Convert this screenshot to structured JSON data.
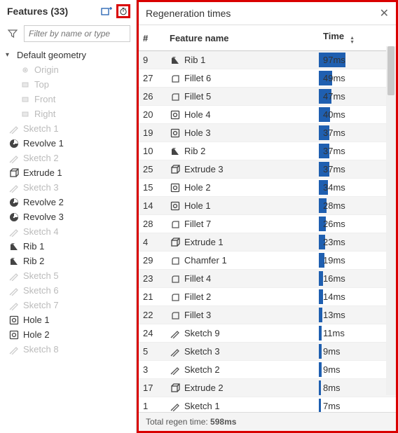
{
  "left": {
    "title": "Features (33)",
    "filter_placeholder": "Filter by name or type",
    "group": "Default geometry",
    "children": [
      "Origin",
      "Top",
      "Front",
      "Right"
    ],
    "features": [
      {
        "name": "Sketch 1",
        "icon": "sketch",
        "dim": true
      },
      {
        "name": "Revolve 1",
        "icon": "revolve",
        "dim": false
      },
      {
        "name": "Sketch 2",
        "icon": "sketch",
        "dim": true
      },
      {
        "name": "Extrude 1",
        "icon": "extrude",
        "dim": false
      },
      {
        "name": "Sketch 3",
        "icon": "sketch",
        "dim": true
      },
      {
        "name": "Revolve 2",
        "icon": "revolve",
        "dim": false
      },
      {
        "name": "Revolve 3",
        "icon": "revolve",
        "dim": false
      },
      {
        "name": "Sketch 4",
        "icon": "sketch",
        "dim": true
      },
      {
        "name": "Rib 1",
        "icon": "rib",
        "dim": false
      },
      {
        "name": "Rib 2",
        "icon": "rib",
        "dim": false
      },
      {
        "name": "Sketch 5",
        "icon": "sketch",
        "dim": true
      },
      {
        "name": "Sketch 6",
        "icon": "sketch",
        "dim": true
      },
      {
        "name": "Sketch 7",
        "icon": "sketch",
        "dim": true
      },
      {
        "name": "Hole 1",
        "icon": "hole",
        "dim": false
      },
      {
        "name": "Hole 2",
        "icon": "hole",
        "dim": false
      },
      {
        "name": "Sketch 8",
        "icon": "sketch",
        "dim": true
      }
    ]
  },
  "right": {
    "title": "Regeneration times",
    "col_num": "#",
    "col_name": "Feature name",
    "col_time": "Time",
    "rows": [
      {
        "n": 9,
        "name": "Rib 1",
        "icon": "rib",
        "time": "97ms",
        "bar": 38
      },
      {
        "n": 27,
        "name": "Fillet 6",
        "icon": "fillet",
        "time": "49ms",
        "bar": 19
      },
      {
        "n": 26,
        "name": "Fillet 5",
        "icon": "fillet",
        "time": "47ms",
        "bar": 18
      },
      {
        "n": 20,
        "name": "Hole 4",
        "icon": "hole",
        "time": "40ms",
        "bar": 16
      },
      {
        "n": 19,
        "name": "Hole 3",
        "icon": "hole",
        "time": "37ms",
        "bar": 15
      },
      {
        "n": 10,
        "name": "Rib 2",
        "icon": "rib",
        "time": "37ms",
        "bar": 15
      },
      {
        "n": 25,
        "name": "Extrude 3",
        "icon": "extrude",
        "time": "37ms",
        "bar": 15
      },
      {
        "n": 15,
        "name": "Hole 2",
        "icon": "hole",
        "time": "34ms",
        "bar": 13
      },
      {
        "n": 14,
        "name": "Hole 1",
        "icon": "hole",
        "time": "28ms",
        "bar": 11
      },
      {
        "n": 28,
        "name": "Fillet 7",
        "icon": "fillet",
        "time": "26ms",
        "bar": 10
      },
      {
        "n": 4,
        "name": "Extrude 1",
        "icon": "extrude",
        "time": "23ms",
        "bar": 9
      },
      {
        "n": 29,
        "name": "Chamfer 1",
        "icon": "fillet",
        "time": "19ms",
        "bar": 8
      },
      {
        "n": 23,
        "name": "Fillet 4",
        "icon": "fillet",
        "time": "16ms",
        "bar": 6
      },
      {
        "n": 21,
        "name": "Fillet 2",
        "icon": "fillet",
        "time": "14ms",
        "bar": 6
      },
      {
        "n": 22,
        "name": "Fillet 3",
        "icon": "fillet",
        "time": "13ms",
        "bar": 5
      },
      {
        "n": 24,
        "name": "Sketch 9",
        "icon": "sketch",
        "time": "11ms",
        "bar": 4
      },
      {
        "n": 5,
        "name": "Sketch 3",
        "icon": "sketch",
        "time": "9ms",
        "bar": 4
      },
      {
        "n": 3,
        "name": "Sketch 2",
        "icon": "sketch",
        "time": "9ms",
        "bar": 4
      },
      {
        "n": 17,
        "name": "Extrude 2",
        "icon": "extrude",
        "time": "8ms",
        "bar": 3
      },
      {
        "n": 1,
        "name": "Sketch 1",
        "icon": "sketch",
        "time": "7ms",
        "bar": 3
      }
    ],
    "footer_label": "Total regen time: ",
    "footer_value": "598ms"
  }
}
